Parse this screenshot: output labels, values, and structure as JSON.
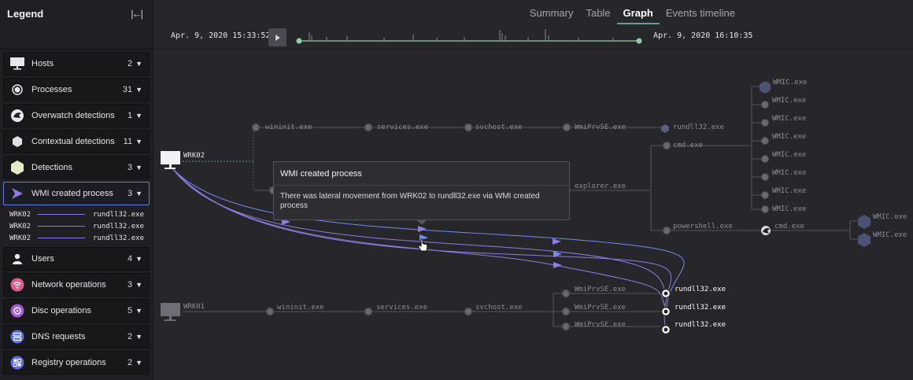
{
  "tabs": [
    {
      "label": "Summary",
      "active": false
    },
    {
      "label": "Table",
      "active": false
    },
    {
      "label": "Graph",
      "active": true
    },
    {
      "label": "Events timeline",
      "active": false
    }
  ],
  "timeline": {
    "start": "Apr. 9, 2020 15:33:52",
    "end": "Apr. 9, 2020 16:10:35"
  },
  "legend": {
    "title": "Legend",
    "items": [
      {
        "label": "Hosts",
        "count": "2",
        "icon": "monitor-icon"
      },
      {
        "label": "Processes",
        "count": "31",
        "icon": "process-circle-icon"
      },
      {
        "label": "Overwatch detections",
        "count": "1",
        "icon": "falcon-icon"
      },
      {
        "label": "Contextual detections",
        "count": "11",
        "icon": "hexagon-icon"
      },
      {
        "label": "Detections",
        "count": "3",
        "icon": "hexagon-large-icon"
      },
      {
        "label": "WMI created process",
        "count": "3",
        "icon": "arrow-icon",
        "selected": true
      },
      {
        "label": "Users",
        "count": "4",
        "icon": "user-icon"
      },
      {
        "label": "Network operations",
        "count": "3",
        "icon": "wifi-icon"
      },
      {
        "label": "Disc operations",
        "count": "5",
        "icon": "disc-icon"
      },
      {
        "label": "DNS requests",
        "count": "2",
        "icon": "dns-icon"
      },
      {
        "label": "Registry operations",
        "count": "2",
        "icon": "registry-icon"
      }
    ],
    "wmi_rows": [
      {
        "from": "WRK02",
        "to": "rundll32.exe"
      },
      {
        "from": "WRK02",
        "to": "rundll32.exe"
      },
      {
        "from": "WRK02",
        "to": "rundll32.exe"
      }
    ]
  },
  "graph": {
    "host_wrk02": "WRK02",
    "host_wrk01": "WRK01",
    "wrk02_chain": [
      "wininit.exe",
      "services.exe",
      "svchost.exe",
      "WmiPrvSE.exe",
      "rundll32.exe"
    ],
    "explorer": "explorer.exe",
    "cmd": "cmd.exe",
    "powershell": "powershell.exe",
    "cmd2": "cmd.exe",
    "wmic_list": [
      "WMIC.exe",
      "WMIC.exe",
      "WMIC.exe",
      "WMIC.exe",
      "WMIC.exe",
      "WMIC.exe",
      "WMIC.exe",
      "WMIC.exe"
    ],
    "wmic_right": [
      "WMIC.exe",
      "WMIC.exe"
    ],
    "wrk01_chain": [
      "wininit.exe",
      "services.exe",
      "svchost.exe"
    ],
    "wmiprvse_list": [
      "WmiPrvSE.exe",
      "WmiPrvSE.exe",
      "WmiPrvSE.exe"
    ],
    "rundll_targets": [
      "rundll32.exe",
      "rundll32.exe",
      "rundll32.exe"
    ]
  },
  "tooltip": {
    "title": "WMI created process",
    "body": "There was lateral movement from WRK02 to rundll32.exe via WMI created process"
  },
  "colors": {
    "accent_tab": "#6e9aa0",
    "selection": "#5f80d8",
    "wmi_edge": "#8e7de0",
    "timeline_dot": "#8fd0a8"
  }
}
